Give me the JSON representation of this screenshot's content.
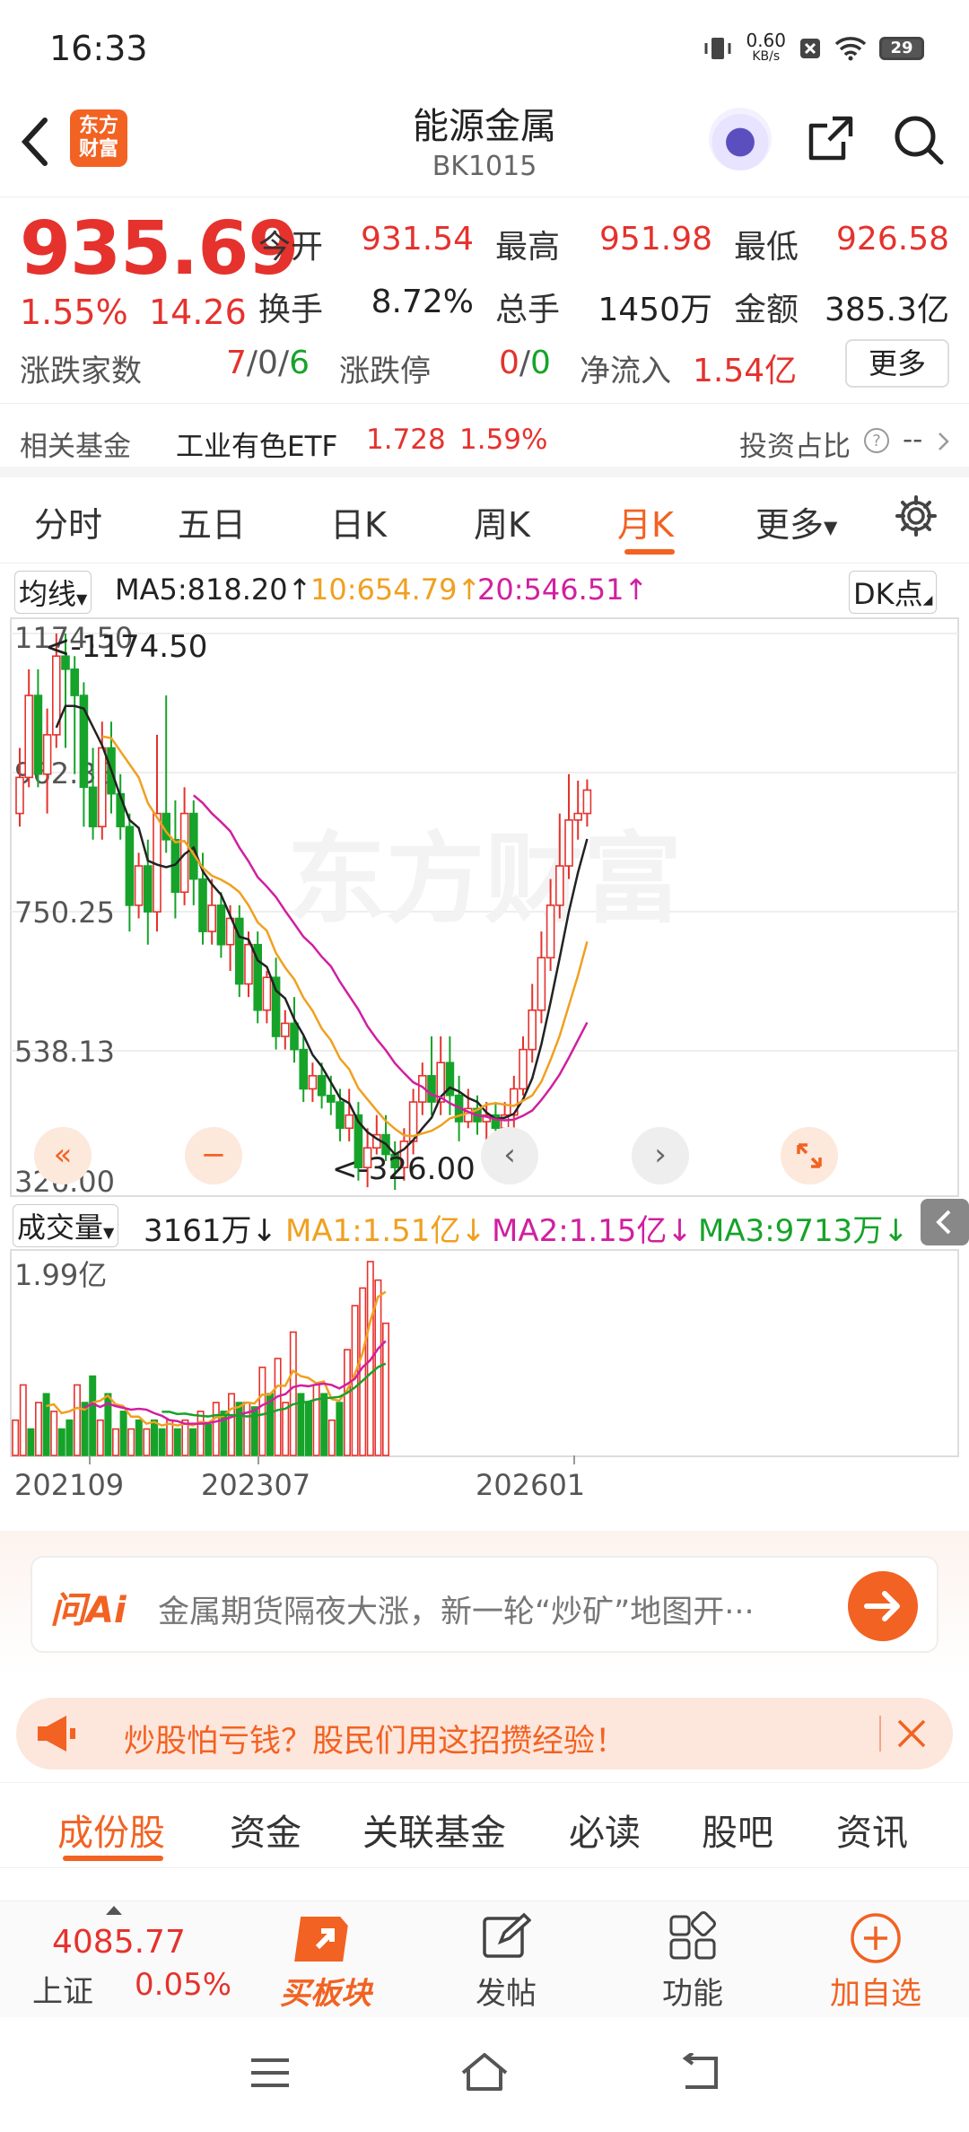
{
  "status": {
    "time": "16:33",
    "net_speed": "0.60",
    "net_unit": "KB/s",
    "battery": "29"
  },
  "header": {
    "logo_text": "东方财富",
    "title": "能源金属",
    "code": "BK1015"
  },
  "quote": {
    "price": "935.69",
    "change_pct": "1.55%",
    "change": "14.26",
    "open_label": "今开",
    "open": "931.54",
    "high_label": "最高",
    "high": "951.98",
    "low_label": "最低",
    "low": "926.58",
    "turnover_label": "换手",
    "turnover": "8.72%",
    "volume_label": "总手",
    "volume": "1450万",
    "amount_label": "金额",
    "amount": "385.3亿",
    "updown_label": "涨跌家数",
    "up": "7",
    "flat": "0",
    "down": "6",
    "slash": "/",
    "limit_label": "涨跌停",
    "limit_up": "0",
    "limit_down": "0",
    "netflow_label": "净流入",
    "netflow": "1.54亿",
    "more": "更多"
  },
  "fund": {
    "label": "相关基金",
    "name": "工业有色ETF",
    "price": "1.728",
    "pct": "1.59%",
    "invest_label": "投资占比",
    "invest_value": "--"
  },
  "tabs": [
    "分时",
    "五日",
    "日K",
    "周K",
    "月K",
    "更多"
  ],
  "active_tab": "月K",
  "ma_legend": {
    "select": "均线",
    "ma5": "MA5:818.20↑",
    "ma10": "10:654.79↑",
    "ma20": "20:546.51↑",
    "dk": "DK点"
  },
  "vol_legend": {
    "select": "成交量",
    "vol": "3161万↓",
    "ma1": "MA1:1.51亿↓",
    "ma2": "MA2:1.15亿↓",
    "ma3": "MA3:9713万↓"
  },
  "chart_data": {
    "type": "candlestick",
    "y_ticks": [
      "1174.50",
      "962.38",
      "750.25",
      "538.13",
      "326.00"
    ],
    "ylim": [
      326.0,
      1174.5
    ],
    "max_label": "<-1174.50",
    "min_label": "<-326.00",
    "vol_tick": "1.99亿",
    "x_labels": [
      "202109",
      "202307",
      "202601"
    ],
    "watermark": "东方财富",
    "colors": {
      "up": "#e5322d",
      "down": "#16a32a",
      "ma5": "#222222",
      "ma10": "#f0a020",
      "ma20": "#d020a0"
    },
    "candles": [
      [
        900,
        955,
        1000,
        880
      ],
      [
        955,
        1080,
        1120,
        940
      ],
      [
        1080,
        960,
        1120,
        940
      ],
      [
        960,
        1020,
        1060,
        900
      ],
      [
        1020,
        1140,
        1174.5,
        1000
      ],
      [
        1140,
        1120,
        1174.5,
        1000
      ],
      [
        1120,
        1080,
        1140,
        960
      ],
      [
        1080,
        940,
        1100,
        880
      ],
      [
        940,
        880,
        1000,
        860
      ],
      [
        880,
        1000,
        1040,
        860
      ],
      [
        1000,
        930,
        1040,
        900
      ],
      [
        930,
        880,
        960,
        860
      ],
      [
        880,
        760,
        900,
        720
      ],
      [
        760,
        820,
        840,
        740
      ],
      [
        820,
        750,
        860,
        700
      ],
      [
        750,
        900,
        1020,
        720
      ],
      [
        900,
        860,
        1080,
        840
      ],
      [
        860,
        780,
        920,
        740
      ],
      [
        780,
        900,
        940,
        760
      ],
      [
        900,
        800,
        920,
        760
      ],
      [
        800,
        720,
        840,
        700
      ],
      [
        720,
        760,
        800,
        700
      ],
      [
        760,
        700,
        780,
        680
      ],
      [
        700,
        740,
        760,
        660
      ],
      [
        740,
        640,
        760,
        620
      ],
      [
        640,
        700,
        720,
        620
      ],
      [
        700,
        600,
        720,
        580
      ],
      [
        600,
        650,
        660,
        580
      ],
      [
        650,
        560,
        680,
        540
      ],
      [
        560,
        580,
        600,
        540
      ],
      [
        580,
        540,
        620,
        520
      ],
      [
        540,
        480,
        560,
        460
      ],
      [
        480,
        500,
        520,
        460
      ],
      [
        500,
        470,
        520,
        450
      ],
      [
        470,
        460,
        500,
        440
      ],
      [
        460,
        420,
        480,
        400
      ],
      [
        420,
        440,
        480,
        400
      ],
      [
        440,
        360,
        460,
        340
      ],
      [
        360,
        390,
        420,
        330
      ],
      [
        390,
        410,
        440,
        380
      ],
      [
        410,
        380,
        440,
        370
      ],
      [
        380,
        360,
        400,
        326
      ],
      [
        360,
        400,
        420,
        340
      ],
      [
        400,
        460,
        480,
        380
      ],
      [
        460,
        500,
        520,
        440
      ],
      [
        500,
        460,
        560,
        440
      ],
      [
        460,
        520,
        560,
        440
      ],
      [
        520,
        470,
        560,
        440
      ],
      [
        470,
        430,
        500,
        400
      ],
      [
        430,
        450,
        480,
        420
      ],
      [
        450,
        430,
        470,
        410
      ],
      [
        430,
        440,
        460,
        400
      ],
      [
        440,
        420,
        460,
        400
      ],
      [
        420,
        440,
        460,
        410
      ],
      [
        440,
        480,
        500,
        420
      ],
      [
        480,
        540,
        560,
        470
      ],
      [
        540,
        600,
        640,
        520
      ],
      [
        600,
        680,
        720,
        580
      ],
      [
        680,
        760,
        800,
        660
      ],
      [
        760,
        820,
        900,
        740
      ],
      [
        820,
        890,
        960,
        800
      ],
      [
        890,
        900,
        950,
        860
      ],
      [
        900,
        935.69,
        951.98,
        880
      ]
    ],
    "volumes": [
      40,
      80,
      30,
      60,
      70,
      50,
      30,
      40,
      80,
      60,
      90,
      40,
      70,
      30,
      50,
      30,
      40,
      30,
      40,
      30,
      40,
      30,
      40,
      30,
      50,
      35,
      60,
      50,
      70,
      60,
      60,
      55,
      100,
      70,
      110,
      60,
      140,
      70,
      60,
      80,
      70,
      40,
      60,
      120,
      170,
      190,
      220,
      199,
      150
    ],
    "vol_colors": [
      "u",
      "u",
      "d",
      "u",
      "d",
      "u",
      "d",
      "d",
      "u",
      "d",
      "d",
      "u",
      "d",
      "u",
      "d",
      "u",
      "d",
      "u",
      "d",
      "d",
      "u",
      "d",
      "u",
      "d",
      "u",
      "d",
      "u",
      "d",
      "u",
      "d",
      "u",
      "d",
      "u",
      "d",
      "u",
      "u",
      "u",
      "d",
      "d",
      "u",
      "d",
      "u",
      "d",
      "u",
      "u",
      "u",
      "u",
      "u",
      "u"
    ]
  },
  "ai": {
    "logo": "问Ai",
    "text": "金属期货隔夜大涨，新一轮“炒矿”地图开···"
  },
  "promo": {
    "text": "炒股怕亏钱？股民们用这招攒经验！"
  },
  "subtabs": [
    "成份股",
    "资金",
    "关联基金",
    "必读",
    "股吧",
    "资讯"
  ],
  "active_subtab": "成份股",
  "bottom": {
    "index_value": "4085.77",
    "index_name": "上证",
    "index_pct": "0.05%",
    "buy": "买板块",
    "post": "发帖",
    "func": "功能",
    "add": "加自选"
  }
}
